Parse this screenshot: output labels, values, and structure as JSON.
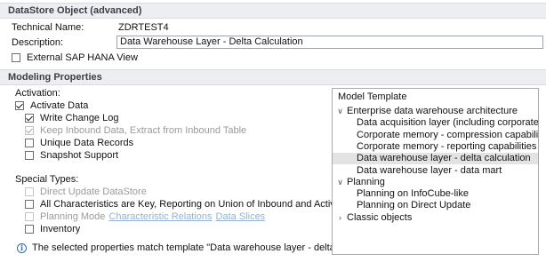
{
  "sections": {
    "datastore_header": "DataStore Object (advanced)",
    "modeling_header": "Modeling Properties"
  },
  "general": {
    "technical_name_label": "Technical Name:",
    "technical_name_value": "ZDRTEST4",
    "description_label": "Description:",
    "description_value": "Data Warehouse Layer - Delta Calculation",
    "external_hana_view_label": "External SAP HANA View",
    "external_hana_view_checked": false
  },
  "activation": {
    "label": "Activation:",
    "activate_data": "Activate Data",
    "write_change_log": "Write Change Log",
    "keep_inbound_data": "Keep Inbound Data, Extract from Inbound Table",
    "unique_data_records": "Unique Data Records",
    "snapshot_support": "Snapshot Support"
  },
  "special_types": {
    "label": "Special Types:",
    "direct_update": "Direct Update DataStore",
    "all_characteristics_key": "All Characteristics are Key, Reporting on Union of Inbound and Active Table",
    "planning_mode": "Planning Mode",
    "characteristic_relations_link": "Characteristic Relations",
    "data_slices_link": "Data Slices",
    "inventory": "Inventory"
  },
  "info_message": "The selected properties match template \"Data warehouse layer - delta calculation\".",
  "model_template": {
    "title": "Model Template",
    "items": [
      {
        "label": "Enterprise data warehouse architecture",
        "level": 0,
        "expander": "expanded"
      },
      {
        "label": "Data acquisition layer (including corporate memory)",
        "level": 1
      },
      {
        "label": "Corporate memory - compression capabilities",
        "level": 1
      },
      {
        "label": "Corporate memory - reporting capabilities",
        "level": 1
      },
      {
        "label": "Data warehouse layer - delta calculation",
        "level": 1,
        "selected": true
      },
      {
        "label": "Data warehouse layer - data mart",
        "level": 1
      },
      {
        "label": "Planning",
        "level": 0,
        "expander": "expanded"
      },
      {
        "label": "Planning on InfoCube-like",
        "level": 1
      },
      {
        "label": "Planning on Direct Update",
        "level": 1
      },
      {
        "label": "Classic objects",
        "level": 0,
        "expander": "collapsed"
      }
    ]
  },
  "icons": {
    "expanded": "chevron-down-icon",
    "collapsed": "chevron-right-icon",
    "info": "info-icon"
  }
}
